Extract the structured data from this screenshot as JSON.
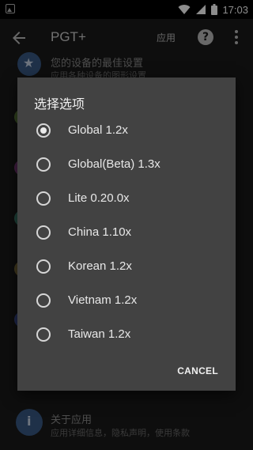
{
  "status_bar": {
    "time": "17:03",
    "icons": [
      "gallery-notification-icon",
      "wifi-icon",
      "signal-icon",
      "battery-icon"
    ]
  },
  "app_bar": {
    "title": "PGT+",
    "apply_label": "应用",
    "help_glyph": "?",
    "icons": [
      "back-arrow-icon",
      "help-icon",
      "more-vert-icon"
    ]
  },
  "background_list": {
    "top_item": {
      "title": "您的设备的最佳设置",
      "subtitle": "应用各种设备的图形设置"
    },
    "bottom_item": {
      "title": "关于应用",
      "subtitle": "应用详细信息，隐私声明，使用条款"
    }
  },
  "dialog": {
    "title": "选择选项",
    "options": [
      {
        "label": "Global 1.2x",
        "checked": true
      },
      {
        "label": "Global(Beta) 1.3x",
        "checked": false
      },
      {
        "label": "Lite 0.20.0x",
        "checked": false
      },
      {
        "label": "China 1.10x",
        "checked": false
      },
      {
        "label": "Korean 1.2x",
        "checked": false
      },
      {
        "label": "Vietnam 1.2x",
        "checked": false
      },
      {
        "label": "Taiwan 1.2x",
        "checked": false
      }
    ],
    "cancel_label": "CANCEL"
  },
  "colors": {
    "dialog_bg": "#424242",
    "app_bar_bg": "#1b1b1b",
    "icon_accent": "#3a5a85"
  }
}
